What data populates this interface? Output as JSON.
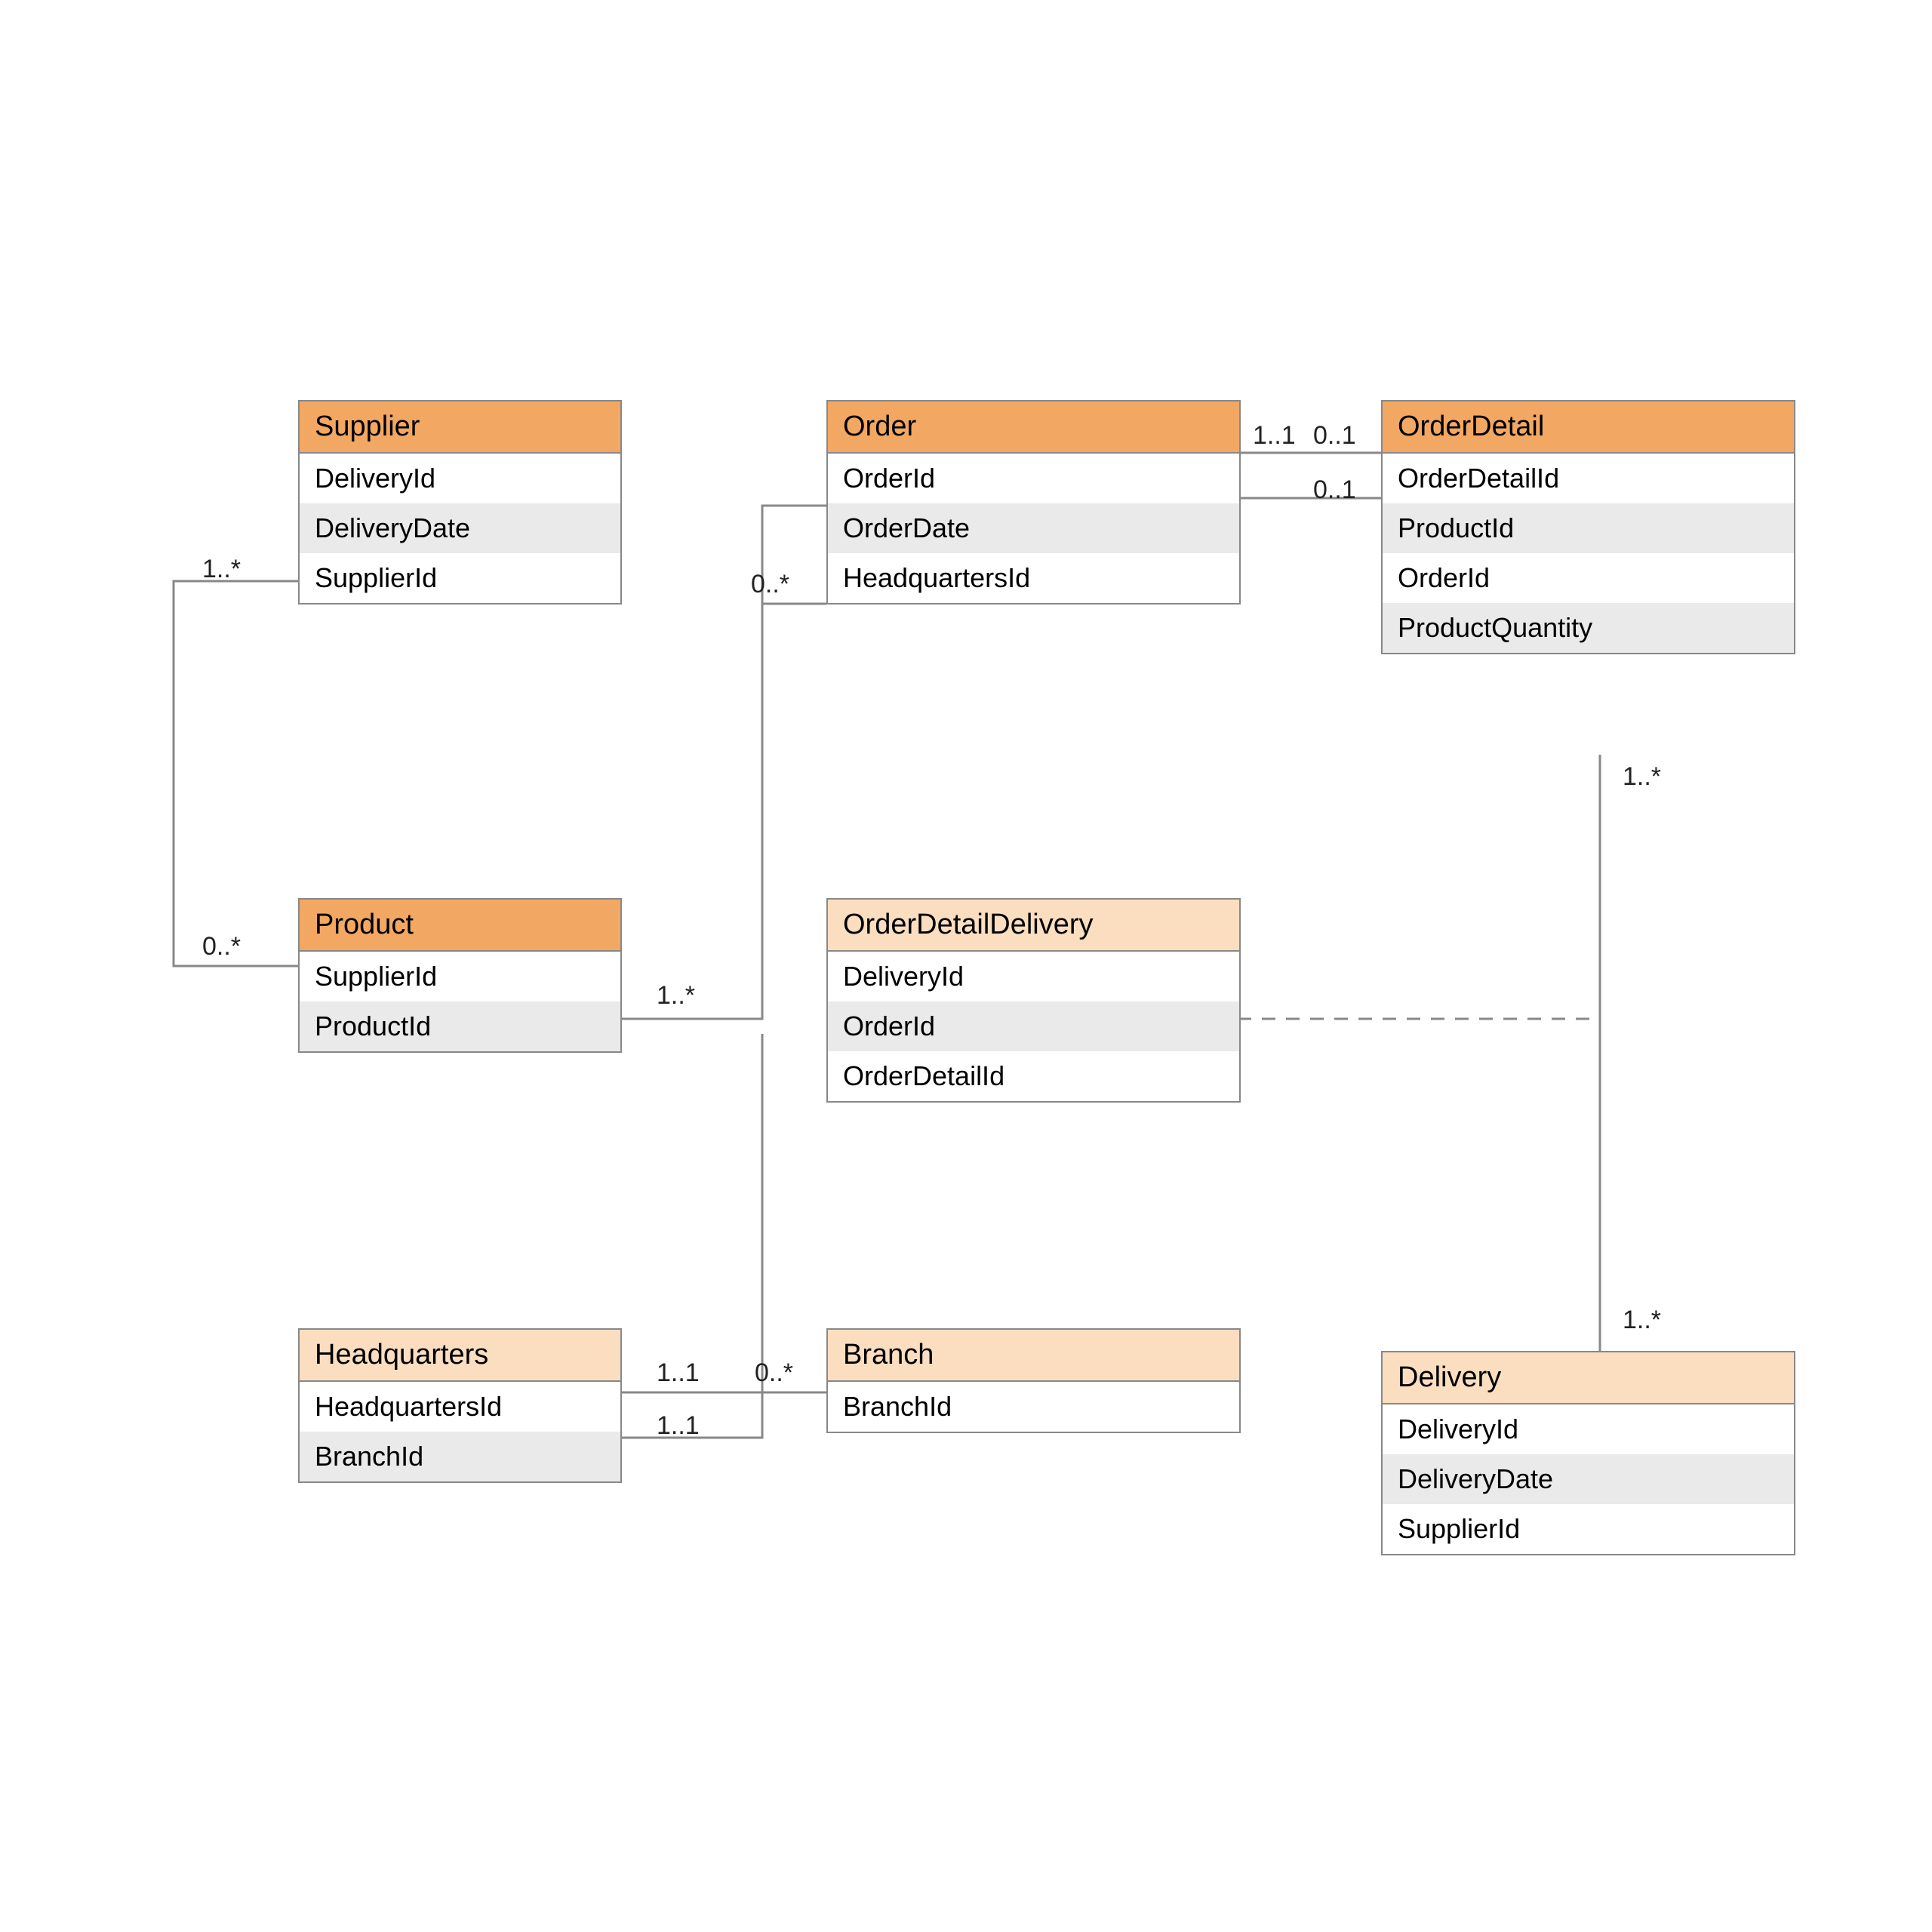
{
  "entities": {
    "supplier": {
      "title": "Supplier",
      "attrs": [
        "DeliveryId",
        "DeliveryDate",
        "SupplierId"
      ],
      "header": "dark"
    },
    "order": {
      "title": "Order",
      "attrs": [
        "OrderId",
        "OrderDate",
        "HeadquartersId"
      ],
      "header": "dark"
    },
    "orderDetail": {
      "title": "OrderDetail",
      "attrs": [
        "OrderDetailId",
        "ProductId",
        "OrderId",
        "ProductQuantity"
      ],
      "header": "dark"
    },
    "product": {
      "title": "Product",
      "attrs": [
        "SupplierId",
        "ProductId"
      ],
      "header": "dark"
    },
    "odd": {
      "title": "OrderDetailDelivery",
      "attrs": [
        "DeliveryId",
        "OrderId",
        "OrderDetailId"
      ],
      "header": "light"
    },
    "headquarters": {
      "title": "Headquarters",
      "attrs": [
        "HeadquartersId",
        "BranchId"
      ],
      "header": "light"
    },
    "branch": {
      "title": "Branch",
      "attrs": [
        "BranchId"
      ],
      "header": "light"
    },
    "delivery": {
      "title": "Delivery",
      "attrs": [
        "DeliveryId",
        "DeliveryDate",
        "SupplierId"
      ],
      "header": "light"
    }
  },
  "multiplicities": {
    "m1": "1..*",
    "m2": "0..*",
    "m3": "1..*",
    "m4": "0..*",
    "m5": "1..1",
    "m6": "0..1",
    "m7": "0..1",
    "m8": "1..*",
    "m9": "1..*",
    "m10": "1..1",
    "m11": "1..1",
    "m12": "0..*"
  }
}
